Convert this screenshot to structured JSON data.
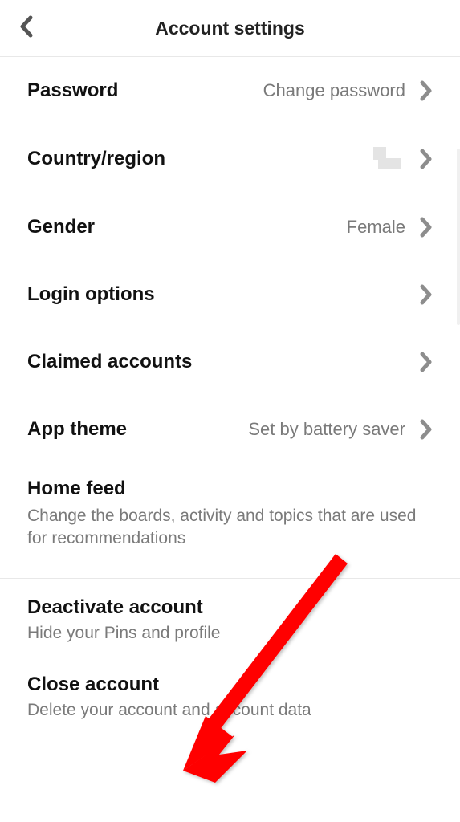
{
  "header": {
    "title": "Account settings"
  },
  "rows": {
    "password": {
      "label": "Password",
      "value": "Change password"
    },
    "country": {
      "label": "Country/region"
    },
    "gender": {
      "label": "Gender",
      "value": "Female"
    },
    "login": {
      "label": "Login options"
    },
    "claimed": {
      "label": "Claimed accounts"
    },
    "theme": {
      "label": "App theme",
      "value": "Set by battery saver"
    }
  },
  "homefeed": {
    "label": "Home feed",
    "desc": "Change the boards, activity and topics that are used for recommendations"
  },
  "deactivate": {
    "label": "Deactivate account",
    "desc": "Hide your Pins and profile"
  },
  "close": {
    "label": "Close account",
    "desc": "Delete your account and account data"
  },
  "annotation": {
    "color": "#ff0000"
  }
}
